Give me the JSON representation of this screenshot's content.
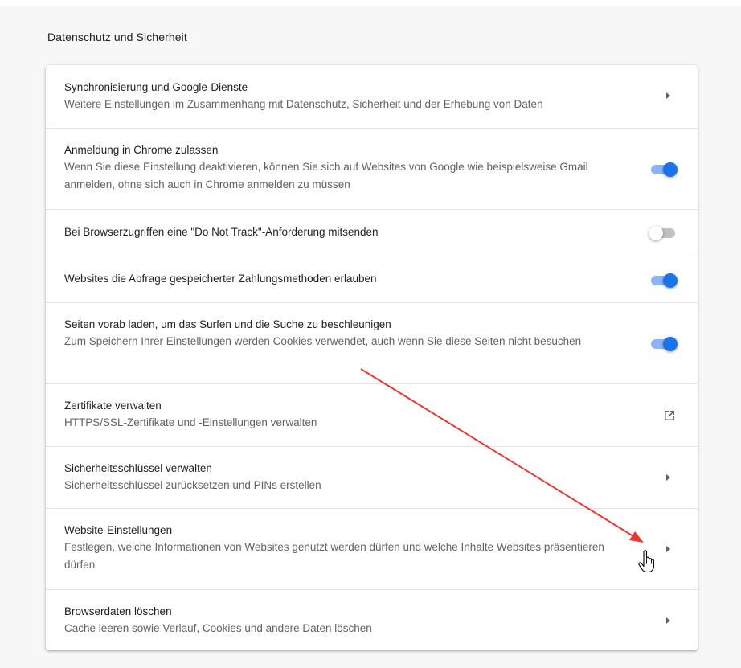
{
  "section": {
    "title": "Datenschutz und Sicherheit"
  },
  "rows": [
    {
      "label": "Synchronisierung und Google-Dienste",
      "sub": "Weitere Einstellungen im Zusammenhang mit Datenschutz, Sicherheit und der Erhebung von Daten",
      "control": "chevron"
    },
    {
      "label": "Anmeldung in Chrome zulassen",
      "sub": "Wenn Sie diese Einstellung deaktivieren, können Sie sich auf Websites von Google wie beispielsweise Gmail anmelden, ohne sich auch in Chrome anmelden zu müssen",
      "control": "toggle",
      "checked": true
    },
    {
      "label": "Bei Browserzugriffen eine \"Do Not Track\"-Anforderung mitsenden",
      "control": "toggle",
      "checked": false
    },
    {
      "label": "Websites die Abfrage gespeicherter Zahlungsmethoden erlauben",
      "control": "toggle",
      "checked": true
    },
    {
      "label": "Seiten vorab laden, um das Surfen und die Suche zu beschleunigen",
      "sub": "Zum Speichern Ihrer Einstellungen werden Cookies verwendet, auch wenn Sie diese Seiten nicht besuchen",
      "control": "toggle",
      "checked": true
    },
    {
      "label": "Zertifikate verwalten",
      "sub": "HTTPS/SSL-Zertifikate und -Einstellungen verwalten",
      "control": "external-link-icon"
    },
    {
      "label": "Sicherheitsschlüssel verwalten",
      "sub": "Sicherheitsschlüssel zurücksetzen und PINs erstellen",
      "control": "chevron"
    },
    {
      "label": "Website-Einstellungen",
      "sub": "Festlegen, welche Informationen von Websites genutzt werden dürfen und welche Inhalte Websites präsentieren dürfen",
      "control": "chevron"
    },
    {
      "label": "Browserdaten löschen",
      "sub": "Cache leeren sowie Verlauf, Cookies und andere Daten löschen",
      "control": "chevron"
    }
  ],
  "colors": {
    "toggle_on_knob": "#1a73e8",
    "toggle_on_track": "#8ab4f8",
    "toggle_off_track": "#bdc1c6",
    "annotation_arrow": "#e53935"
  }
}
